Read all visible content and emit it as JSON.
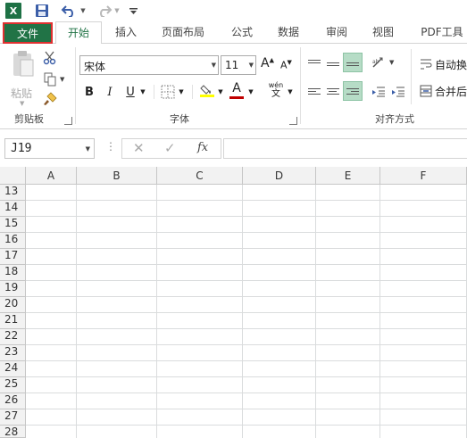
{
  "qat": {
    "app_icon_letter": "X",
    "save_icon": "save-icon",
    "undo_icon": "undo-icon",
    "redo_icon": "redo-icon"
  },
  "tabs": {
    "file": "文件",
    "home": "开始",
    "insert": "插入",
    "page_layout": "页面布局",
    "formulas": "公式",
    "data": "数据",
    "review": "审阅",
    "view": "视图",
    "pdf": "PDF工具"
  },
  "ribbon": {
    "clipboard": {
      "paste_label": "粘贴",
      "group_label": "剪贴板"
    },
    "font": {
      "font_name": "宋体",
      "font_size": "11",
      "increase_font": "A",
      "decrease_font": "A",
      "bold": "B",
      "italic": "I",
      "underline": "U",
      "font_color_letter": "A",
      "phonetic_top": "wén",
      "phonetic_bottom": "文",
      "group_label": "字体"
    },
    "alignment": {
      "wrap_text": "自动换",
      "merge_center": "合并后",
      "group_label": "对齐方式"
    }
  },
  "formula_bar": {
    "name_box": "J19",
    "dots": "⋮",
    "cancel": "✕",
    "enter": "✓",
    "fx": "fx",
    "formula": ""
  },
  "grid": {
    "columns": [
      "A",
      "B",
      "C",
      "D",
      "E",
      "F"
    ],
    "rows": [
      "13",
      "14",
      "15",
      "16",
      "17",
      "18",
      "19",
      "20",
      "21",
      "22",
      "23",
      "24",
      "25",
      "26",
      "27",
      "28"
    ]
  },
  "colors": {
    "excel_green": "#217346",
    "highlight_red": "#e03030",
    "active_align": "#b6dcc6",
    "fill_yellow": "#ffff00",
    "font_red": "#c00000"
  }
}
